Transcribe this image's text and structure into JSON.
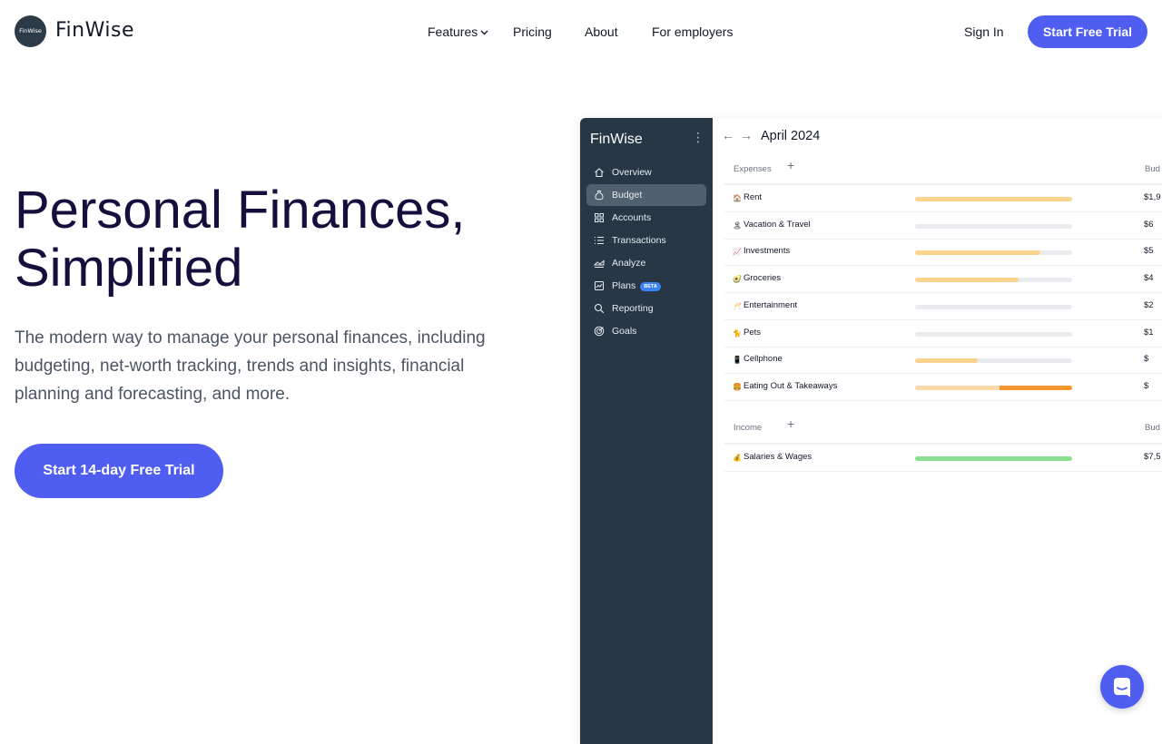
{
  "brand": {
    "badge": "FinWise",
    "name": "FinWise"
  },
  "nav": [
    {
      "label": "Features",
      "has_dropdown": true
    },
    {
      "label": "Pricing"
    },
    {
      "label": "About"
    },
    {
      "label": "For employers"
    }
  ],
  "auth": {
    "sign_in": "Sign In",
    "cta": "Start Free Trial"
  },
  "hero": {
    "title_line1": "Personal Finances,",
    "title_line2": "Simplified",
    "subtitle": "The modern way to manage your personal finances, including budgeting, net-worth tracking, trends and insights, financial planning and forecasting, and more.",
    "cta": "Start 14-day Free Trial"
  },
  "app": {
    "brand": "FinWise",
    "menu": [
      {
        "label": "Overview",
        "icon": "home-icon"
      },
      {
        "label": "Budget",
        "icon": "money-bag-icon",
        "active": true
      },
      {
        "label": "Accounts",
        "icon": "grid-icon"
      },
      {
        "label": "Transactions",
        "icon": "list-icon"
      },
      {
        "label": "Analyze",
        "icon": "area-chart-icon"
      },
      {
        "label": "Plans",
        "icon": "line-chart-icon",
        "badge": "BETA"
      },
      {
        "label": "Reporting",
        "icon": "search-report-icon"
      },
      {
        "label": "Goals",
        "icon": "target-icon"
      }
    ],
    "month": "April 2024",
    "expenses": {
      "label": "Expenses",
      "column": "Bud",
      "rows": [
        {
          "emoji": "🏠",
          "name": "Rent",
          "amount": "$1,9",
          "progress": 1.0,
          "color": "#fbd38d"
        },
        {
          "emoji": "🏝",
          "name": "Vacation & Travel",
          "amount": "$6",
          "progress": 0.0,
          "color": "#fbd38d"
        },
        {
          "emoji": "📈",
          "name": "Investments",
          "amount": "$5",
          "progress": 0.8,
          "color": "#fbd38d"
        },
        {
          "emoji": "🥑",
          "name": "Groceries",
          "amount": "$4",
          "progress": 0.66,
          "color": "#fbd38d"
        },
        {
          "emoji": "🥂",
          "name": "Entertainment",
          "amount": "$2",
          "progress": 0.0,
          "color": "#fbd38d"
        },
        {
          "emoji": "🐈",
          "name": "Pets",
          "amount": "$1",
          "progress": 0.0,
          "color": "#fbd38d"
        },
        {
          "emoji": "📱",
          "name": "Cellphone",
          "amount": "$",
          "progress": 0.4,
          "color": "#fbd38d"
        },
        {
          "emoji": "🍔",
          "name": "Eating Out & Takeaways",
          "amount": "$",
          "progress": 1.0,
          "over": 0.46,
          "color": "#fcd9a8",
          "over_color": "#f5962e"
        }
      ]
    },
    "income": {
      "label": "Income",
      "column": "Bud",
      "rows": [
        {
          "emoji": "💰",
          "name": "Salaries & Wages",
          "amount": "$7,5",
          "progress": 1.0,
          "color": "#86e08e"
        }
      ]
    }
  }
}
